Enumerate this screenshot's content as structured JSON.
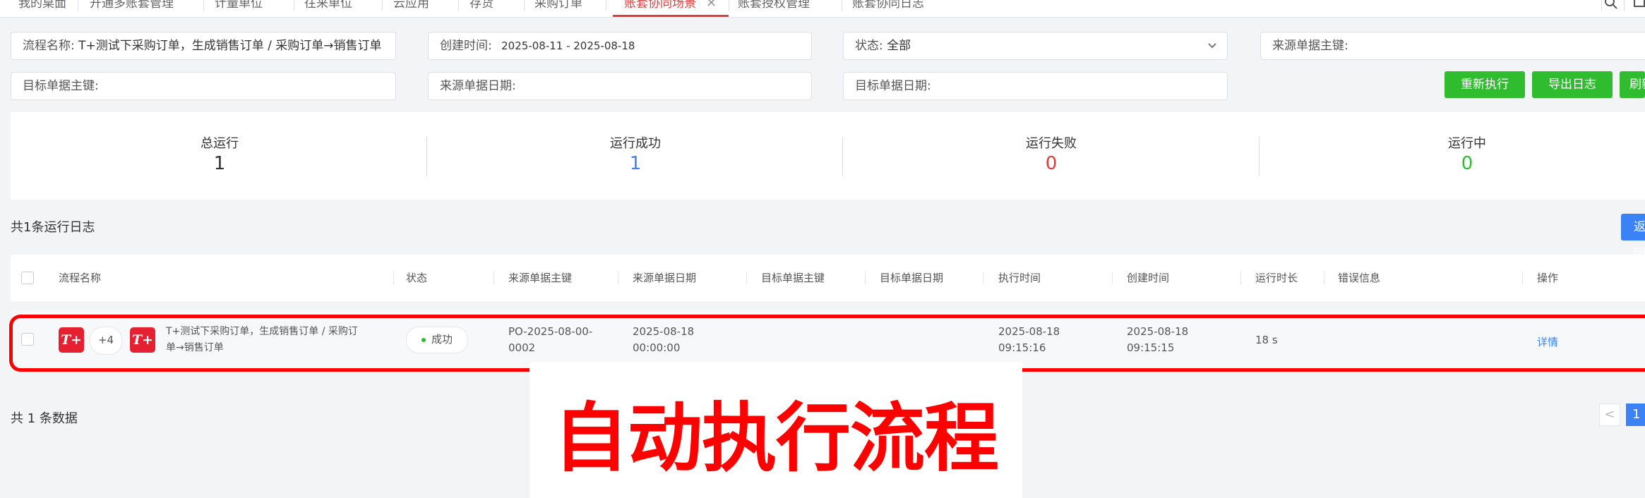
{
  "tabs": [
    {
      "label": "我的桌面"
    },
    {
      "label": "开通多账套管理"
    },
    {
      "label": "计量单位"
    },
    {
      "label": "往来单位"
    },
    {
      "label": "云应用"
    },
    {
      "label": "存货"
    },
    {
      "label": "采购订单"
    },
    {
      "label": "账套协同场景",
      "active": true
    },
    {
      "label": "账套授权管理"
    },
    {
      "label": "账套协同日志"
    }
  ],
  "icons": {
    "search": "search-icon",
    "tab_close": "close-icon",
    "window": "window-icon"
  },
  "filters": {
    "flow_name": {
      "label": "流程名称:",
      "value": "T+测试下采购订单，生成销售订单 / 采购订单→销售订单"
    },
    "created_time": {
      "label": "创建时间:",
      "value": "2025-08-11 - 2025-08-18"
    },
    "status": {
      "label": "状态:",
      "value": "全部"
    },
    "source_key": {
      "label": "来源单据主键:",
      "value": ""
    },
    "target_key": {
      "label": "目标单据主键:",
      "value": ""
    },
    "source_date": {
      "label": "来源单据日期:",
      "value": ""
    },
    "target_date": {
      "label": "目标单据日期:",
      "value": ""
    }
  },
  "actions": {
    "rerun": "重新执行",
    "export_log": "导出日志",
    "refresh": "刷新",
    "back": "返回"
  },
  "stats": {
    "total": {
      "label": "总运行",
      "value": "1"
    },
    "success": {
      "label": "运行成功",
      "value": "1"
    },
    "failed": {
      "label": "运行失败",
      "value": "0"
    },
    "running": {
      "label": "运行中",
      "value": "0"
    }
  },
  "log_summary": "共1条运行日志",
  "table": {
    "columns": [
      "流程名称",
      "状态",
      "来源单据主键",
      "来源单据日期",
      "目标单据主键",
      "目标单据日期",
      "执行时间",
      "创建时间",
      "运行时长",
      "错误信息",
      "操作"
    ],
    "rows": [
      {
        "logo_text": "T+",
        "extra_count": "+4",
        "flow_line1": "T+测试下采购订单，生成销售订单 / 采购订",
        "flow_line2": "单→销售订单",
        "status": "成功",
        "source_key_line1": "PO-2025-08-00-",
        "source_key_line2": "0002",
        "source_date_line1": "2025-08-18",
        "source_date_line2": "00:00:00",
        "target_key": "",
        "target_date": "",
        "exec_time_line1": "2025-08-18",
        "exec_time_line2": "09:15:16",
        "created_line1": "2025-08-18",
        "created_line2": "09:15:15",
        "duration": "18 s",
        "error": "",
        "action": "详情"
      }
    ]
  },
  "pagination": {
    "total_text": "共 1 条数据",
    "prev": "<",
    "current": "1"
  },
  "overlay_caption": "自动执行流程",
  "colors": {
    "accent_red": "#e23b3b",
    "green": "#2fbd2f",
    "blue": "#3b82f6",
    "highlight": "#ff0000"
  }
}
